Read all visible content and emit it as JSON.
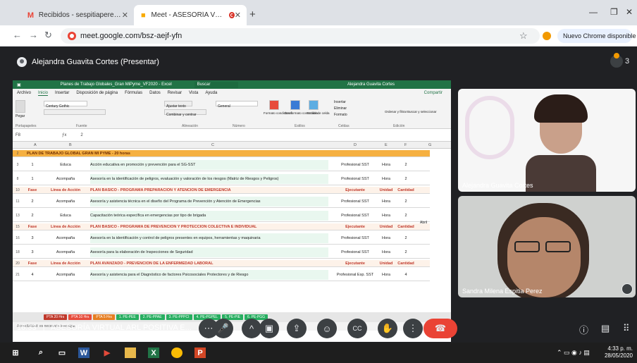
{
  "browser": {
    "tabs": [
      {
        "label": "Recibidos - sespitiaperez@gma",
        "close": "✕"
      },
      {
        "label": "Meet - ASESORÍA VIRTUAL",
        "close": "✕"
      }
    ],
    "new_tab": "+",
    "url": "meet.google.com/bsz-aejf-yfn",
    "update_pill": "Nuevo Chrome disponible",
    "minimize": "—",
    "restore": "❐",
    "close": "✕"
  },
  "meet": {
    "presenter": "Alejandra Guavita Cortes (Presentar)",
    "participant_count": "3",
    "time": "16:33",
    "meeting_name": "ASESORÍA VIRTUAL ARL POSITIVA E...",
    "participants": [
      {
        "name": "Alejandra Guavita Cortes"
      },
      {
        "name": "Sandra Milena Espitia Perez"
      }
    ]
  },
  "excel": {
    "title": "Planes de Trabajo Globales_Gran MiPyme_VF2020 - Excel",
    "search": "Buscar",
    "user": "Alejandra Guavita Cortes",
    "menu": [
      "Archivo",
      "Inicio",
      "Insertar",
      "Disposición de página",
      "Fórmulas",
      "Datos",
      "Revisar",
      "Vista",
      "Ayuda"
    ],
    "share": "Compartir",
    "ribbon_groups": [
      "Portapapeles",
      "Fuente",
      "Alineación",
      "Número",
      "Estilos",
      "Celdas",
      "Edición"
    ],
    "ribbon_labels": {
      "font": "Century Gothic",
      "number_format": "General",
      "wrap": "Ajustar texto",
      "merge": "Combinar y centrar",
      "conditional": "Formato condicional",
      "table": "Dar formato como tabla",
      "styles": "Estilos de celda",
      "insert": "Insertar",
      "delete": "Eliminar",
      "format": "Formato",
      "sort": "Ordenar y filtrar",
      "find": "Buscar y seleccionar",
      "paste": "Pegar"
    },
    "name_box": "F8",
    "formula": "2",
    "columns": [
      "A",
      "B",
      "C",
      "D",
      "E",
      "F",
      "G"
    ],
    "rows": [
      {
        "n": "2",
        "b": "",
        "c": "PLAN DE TRABAJO GLOBAL GRAN MI PYME - 20 horas",
        "d": "",
        "e": "",
        "f": "",
        "type": "title"
      },
      {
        "n": "3",
        "b": "1",
        "b2": "Educa",
        "c": "Acción educativa en promoción y prevención para el SG-SST",
        "d": "Profesional SST",
        "e": "Hora",
        "f": "2",
        "type": "data"
      },
      {
        "n": "8",
        "b": "1",
        "b2": "Acompaña",
        "c": "Asesoría en la identificación de peligros, evaluación y valoración de los riesgos (Matriz de Riesgos y Peligros)",
        "d": "Profesional SST",
        "e": "Hora",
        "f": "2",
        "type": "data"
      },
      {
        "n": "10",
        "b": "Fase",
        "b2": "Línea de Acción",
        "c": "PLAN BASICO - PROGRAMA PREPARACIÓN Y ATENCIÓN DE EMERGENCIA",
        "d": "Ejecutante",
        "e": "Unidad",
        "f": "Cantidad",
        "type": "phase"
      },
      {
        "n": "11",
        "b": "2",
        "b2": "Acompaña",
        "c": "Asesoría y asistencia técnica en el diseño del Programa de Prevención y Atención de Emergencias",
        "d": "Profesional SST",
        "e": "Hora",
        "f": "2",
        "type": "data"
      },
      {
        "n": "13",
        "b": "2",
        "b2": "Educa",
        "c": "Capacitación teórica específica en emergencias por tipo de brigada",
        "d": "Profesional SST",
        "e": "Hora",
        "f": "2",
        "type": "data"
      },
      {
        "n": "15",
        "b": "Fase",
        "b2": "Línea de Acción",
        "c": "PLAN BASICO - PROGRAMA DE PREVENCIÓN Y PROTECCIÓN COLECTIVA E INDIVIDUAL",
        "d": "Ejecutante",
        "e": "Unidad",
        "f": "Cantidad",
        "type": "phase"
      },
      {
        "n": "16",
        "b": "3",
        "b2": "Acompaña",
        "c": "Asesoría en la identificación y control de peligros presentes en equipos, herramientas y maquinaria",
        "d": "Profesional SST",
        "e": "Hora",
        "f": "2",
        "type": "data"
      },
      {
        "n": "18",
        "b": "3",
        "b2": "Acompaña",
        "c": "Asesoría para la elaboración de Inspecciones de Seguridad",
        "d": "Profesional SST",
        "e": "Hora",
        "f": "2",
        "type": "data"
      },
      {
        "n": "20",
        "b": "Fase",
        "b2": "Línea de Acción",
        "c": "PLAN AVANZADO - PREVENCIÓN DE LA ENFERMEDAD LABORAL",
        "d": "Ejecutante",
        "e": "Unidad",
        "f": "Cantidad",
        "type": "phase"
      },
      {
        "n": "21",
        "b": "4",
        "b2": "Acompaña",
        "c": "Asesoría y asistencia para el Diagnóstico de factores Psicosociales Protectores y de Riesgo",
        "d": "Profesional Esp. SST",
        "e": "Hora",
        "f": "4",
        "type": "data"
      }
    ],
    "g_note": "Abril",
    "sheet_tabs": [
      {
        "label": "PTA 20 Hrs",
        "color": "#c0392b"
      },
      {
        "label": "PTA 10 Hrs",
        "color": "#e74c3c"
      },
      {
        "label": "PTA 5 Hrs",
        "color": "#e67e22"
      },
      {
        "label": "1. PE-PEE",
        "color": "#27ae60"
      },
      {
        "label": "2. PE-PPAE",
        "color": "#27ae60"
      },
      {
        "label": "3. PE-PPPCI",
        "color": "#27ae60"
      },
      {
        "label": "4. PE-PGPEL",
        "color": "#27ae60"
      },
      {
        "label": "5. PE-PIE",
        "color": "#27ae60"
      },
      {
        "label": "6. PE-PGG",
        "color": "#27ae60"
      }
    ],
    "status": "Accesibilidad: es necesario investigar"
  },
  "controls": {
    "more": "⋯",
    "mic": "🎤",
    "expand": "^",
    "camera": "▣",
    "present": "⇪",
    "emoji": "☺",
    "cc": "CC",
    "hand": "✋",
    "options": "⋮",
    "end": "☎",
    "info": "ⓘ",
    "chat": "▤",
    "activities": "⠿"
  },
  "taskbar": {
    "time": "4:33 p. m.",
    "date": "28/05/2020"
  },
  "colors": {
    "meet_bg": "#202124",
    "excel_green": "#217346",
    "end_call": "#ea4335",
    "title_row": "#f39c12"
  }
}
